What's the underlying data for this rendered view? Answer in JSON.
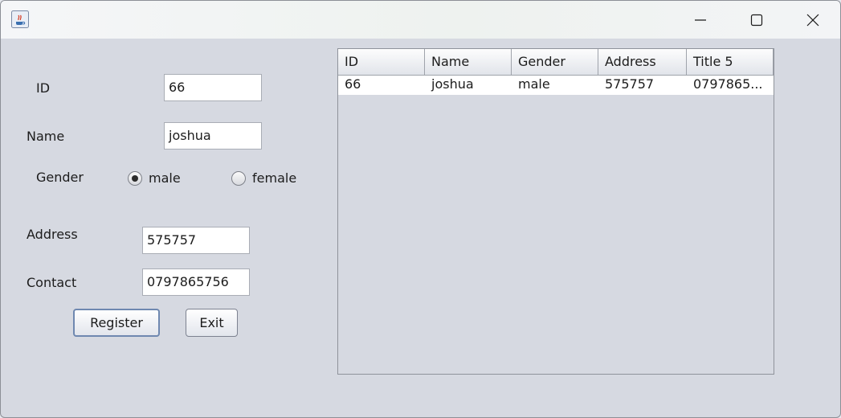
{
  "window": {
    "icon": "java-coffee-cup-icon",
    "controls": {
      "minimize": "minimize-icon",
      "maximize": "maximize-icon",
      "close": "close-icon"
    }
  },
  "form": {
    "id_label": "ID",
    "id_value": "66",
    "name_label": "Name",
    "name_value": "joshua",
    "gender_label": "Gender",
    "gender_options": [
      "male",
      "female"
    ],
    "gender_selected": "male",
    "address_label": "Address",
    "address_value": "575757",
    "contact_label": "Contact",
    "contact_value": "0797865756",
    "register_label": "Register",
    "exit_label": "Exit"
  },
  "table": {
    "columns": [
      "ID",
      "Name",
      "Gender",
      "Address",
      "Title 5"
    ],
    "rows": [
      [
        "66",
        "joshua",
        "male",
        "575757",
        "0797865..."
      ]
    ]
  },
  "colors": {
    "background": "#d6d9e1",
    "field_background": "#ffffff",
    "default_button_border": "#6f88b0"
  }
}
